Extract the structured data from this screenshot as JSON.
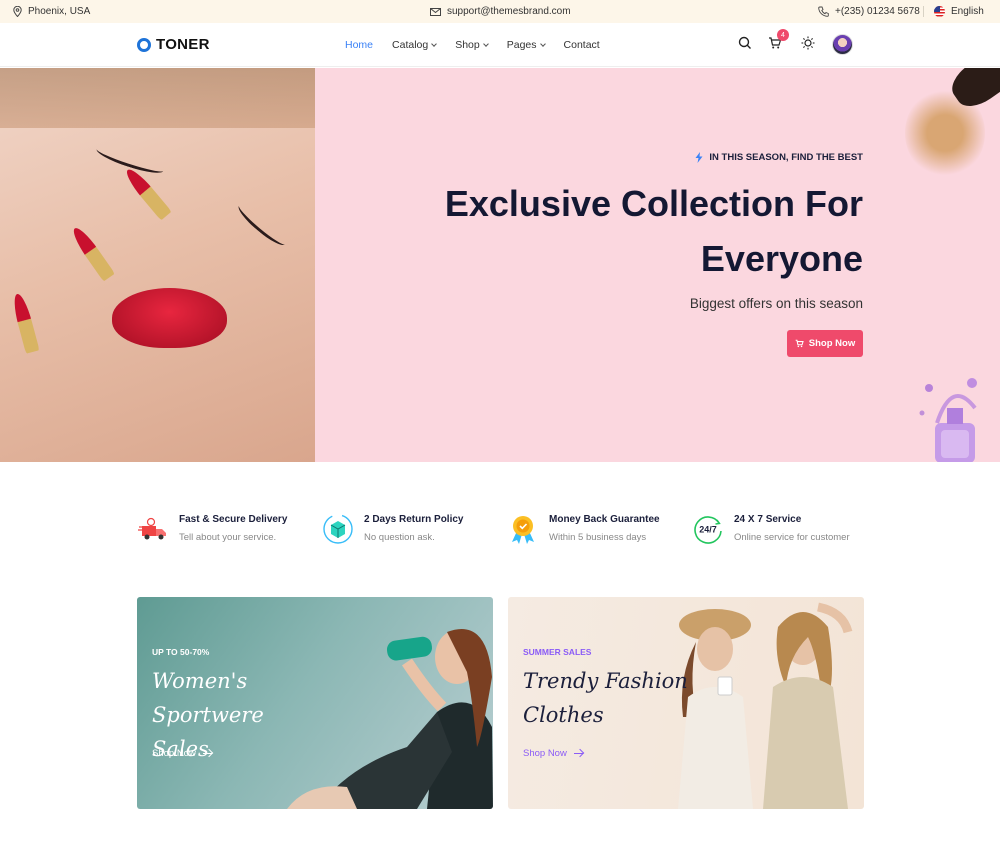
{
  "topbar": {
    "location": "Phoenix, USA",
    "email": "support@themesbrand.com",
    "phone": "+(235) 01234 5678",
    "language": "English"
  },
  "header": {
    "brand": "TONER",
    "nav": [
      {
        "label": "Home",
        "active": true,
        "dropdown": false
      },
      {
        "label": "Catalog",
        "active": false,
        "dropdown": true
      },
      {
        "label": "Shop",
        "active": false,
        "dropdown": true
      },
      {
        "label": "Pages",
        "active": false,
        "dropdown": true
      },
      {
        "label": "Contact",
        "active": false,
        "dropdown": false
      }
    ],
    "cart_count": "4",
    "icons": [
      "search-icon",
      "cart-icon",
      "sun-icon",
      "avatar"
    ]
  },
  "hero": {
    "tagline": "IN THIS SEASON, FIND THE BEST",
    "title_line1": "Exclusive Collection For",
    "title_line2": "Everyone",
    "subtitle": "Biggest offers on this season",
    "cta": "Shop Now"
  },
  "features": [
    {
      "title": "Fast & Secure Delivery",
      "subtitle": "Tell about your service.",
      "icon": "delivery-truck-icon"
    },
    {
      "title": "2 Days Return Policy",
      "subtitle": "No question ask.",
      "icon": "return-box-icon"
    },
    {
      "title": "Money Back Guarantee",
      "subtitle": "Within 5 business days",
      "icon": "guarantee-badge-icon"
    },
    {
      "title": "24 X 7 Service",
      "subtitle": "Online service for customer",
      "icon": "support-24-7-icon"
    }
  ],
  "promos": [
    {
      "kicker": "UP TO 50-70%",
      "title_line1": "Women's Sportwere",
      "title_line2": "Sales",
      "link": "Shop Now"
    },
    {
      "kicker": "SUMMER SALES",
      "title_line1": "Trendy Fashion",
      "title_line2": "Clothes",
      "link": "Shop Now"
    }
  ],
  "colors": {
    "accent": "#ef4a6b",
    "link_blue": "#3b82f6",
    "hero_bg": "#fbd7df",
    "topbar_bg": "#fdf6e9",
    "purple": "#8b5cf6"
  }
}
